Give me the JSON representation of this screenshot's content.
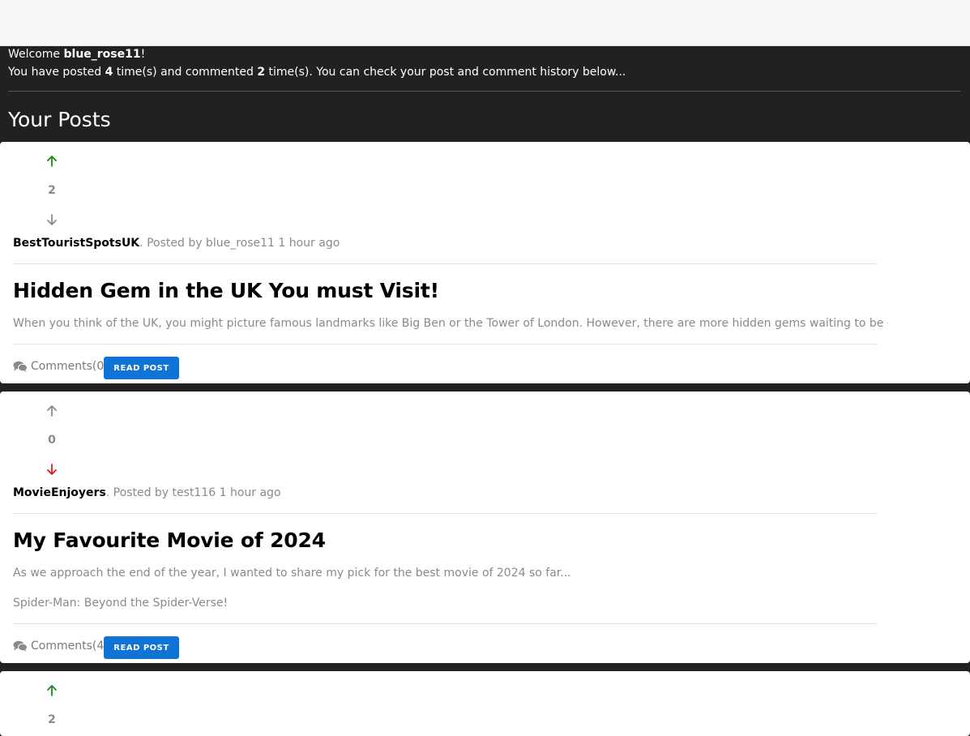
{
  "header": {
    "welcome_prefix": "Welcome ",
    "username": "blue_rose11",
    "welcome_suffix": "!",
    "stats_prefix": "You have posted ",
    "post_count": "4",
    "stats_middle": " time(s) and commented ",
    "comment_count": "2",
    "stats_suffix": " time(s). You can check your post and comment history below..."
  },
  "section_title": "Your Posts",
  "colors": {
    "upvote_active": "#1a8a1a",
    "downvote_active": "#e01b1b",
    "vote_inactive": "#8a8a8a",
    "button": "#0f74d6"
  },
  "posts": [
    {
      "score": "2",
      "vote_state": "up",
      "community": "BestTouristSpotsUK",
      "byline": ". Posted by blue_rose11 1 hour ago",
      "title": "Hidden Gem in the UK You must Visit!",
      "excerpt_lines": [
        "When you think of the UK, you might picture famous landmarks like Big Ben or the Tower of London. However, there are more hidden gems waiting to be discovered..."
      ],
      "comments_label": "Comments(0)",
      "read_label": "READ POST"
    },
    {
      "score": "0",
      "vote_state": "down",
      "community": "MovieEnjoyers",
      "byline": ". Posted by test116 1 hour ago",
      "title": "My Favourite Movie of 2024",
      "excerpt_lines": [
        "As we approach the end of the year, I wanted to share my pick for the best movie of 2024 so far...",
        "Spider-Man: Beyond the Spider-Verse!"
      ],
      "comments_label": "Comments(4)",
      "read_label": "READ POST"
    },
    {
      "score": "2",
      "vote_state": "up"
    }
  ]
}
